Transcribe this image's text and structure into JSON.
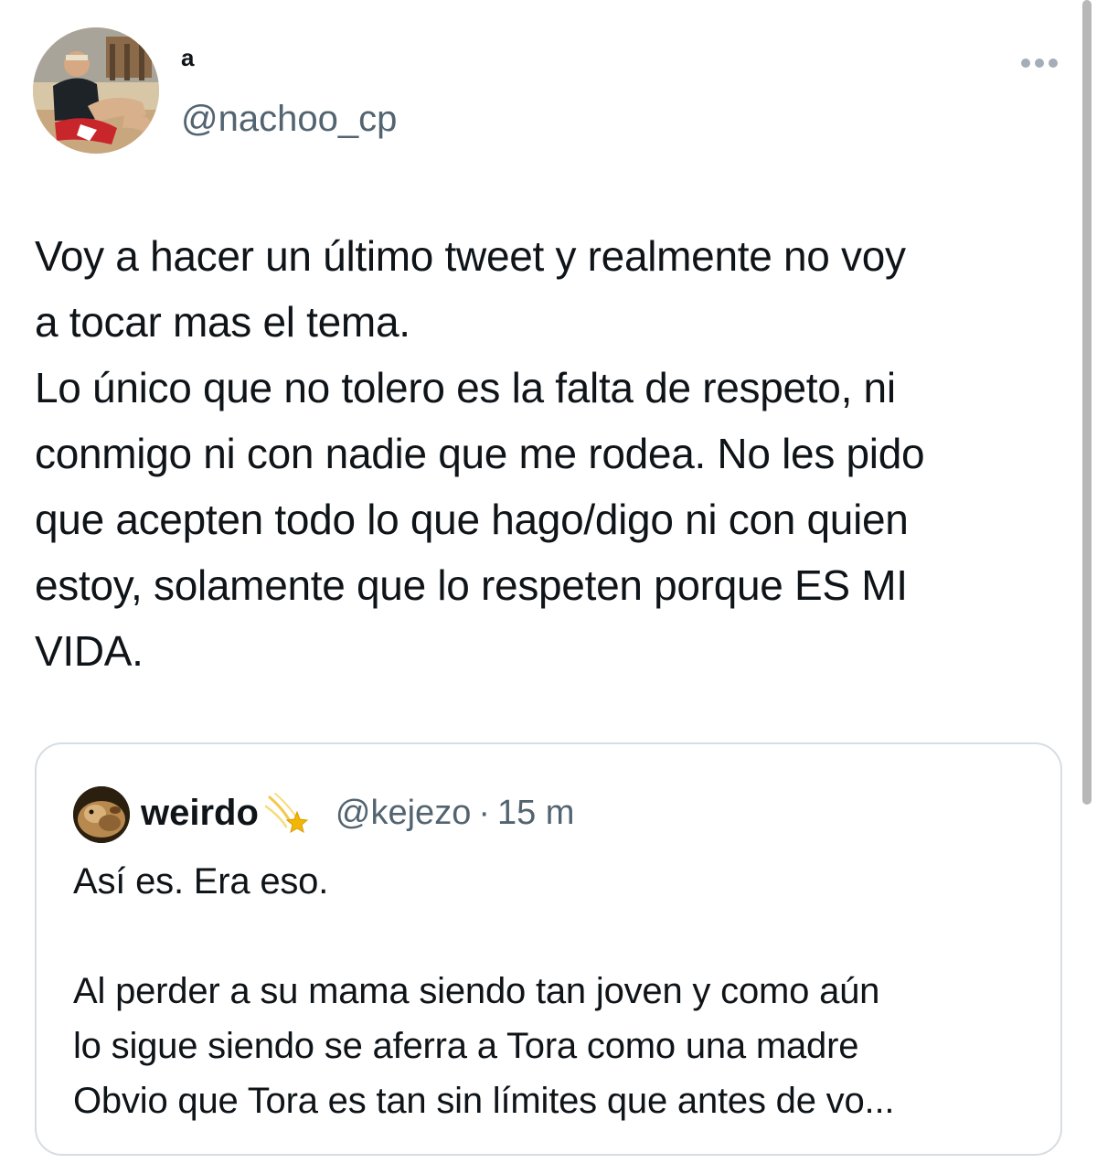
{
  "tweet": {
    "display_name": "a",
    "handle": "@nachoo_cp",
    "more_icon": "more-horizontal-icon",
    "text": "Voy a hacer un último tweet y realmente no voy\na tocar mas el tema.\nLo único que no tolero es la falta de respeto, ni\nconmigo ni con nadie que me rodea. No les pido\nque acepten todo lo que hago/digo ni con quien\nestoy, solamente que lo respeten porque ES MI\nVIDA."
  },
  "quote": {
    "display_name": "weirdo",
    "name_emoji": "shooting-star-emoji",
    "handle": "@kejezo",
    "separator": "·",
    "time": "15 m",
    "text": "Así es. Era eso.\n\nAl perder a su mama siendo tan joven y como aún\nlo sigue siendo se aferra a Tora como una madre\nObvio que Tora es tan sin límites que antes de vo..."
  },
  "colors": {
    "text_primary": "#0f1419",
    "text_secondary": "#536471",
    "border": "#d7dde2"
  }
}
